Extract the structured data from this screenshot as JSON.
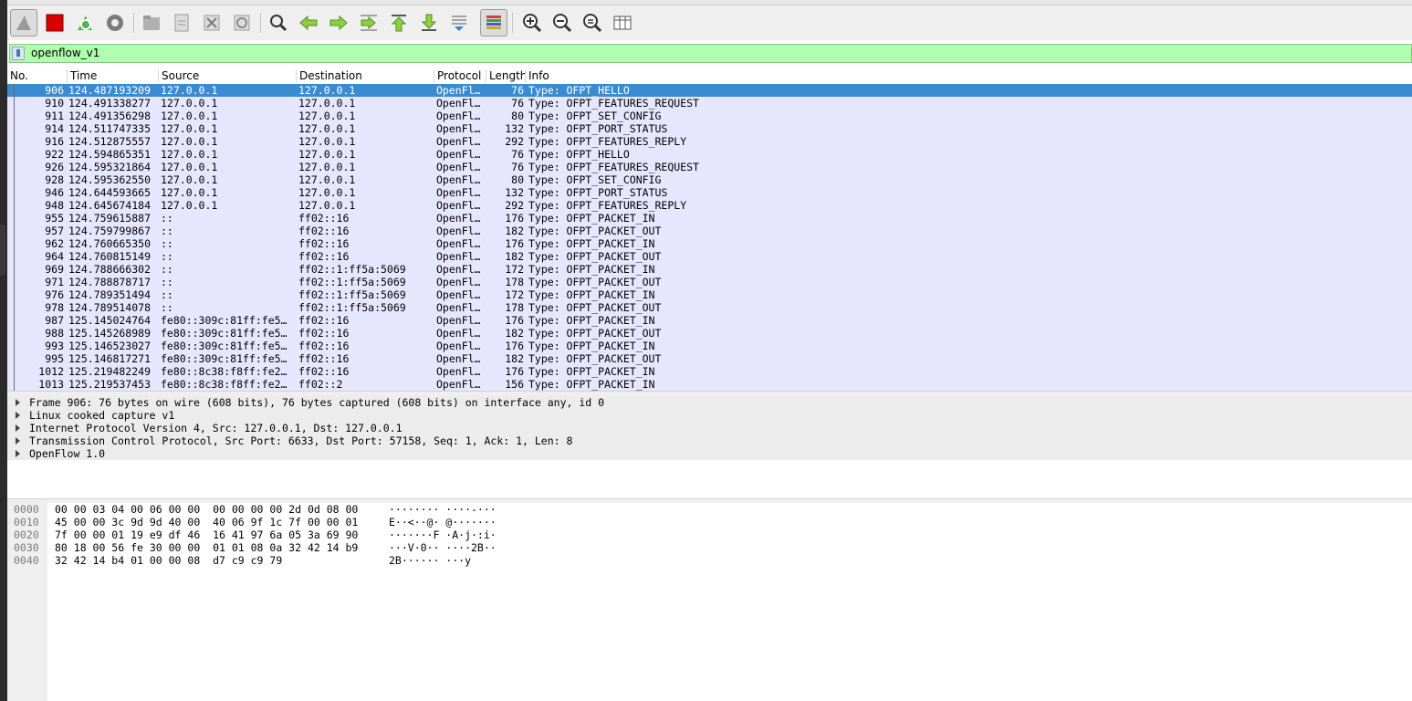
{
  "app": {
    "accent_selected_row": "#3b8bd0",
    "packet_bg": "#e7e6ff",
    "filter_bg": "#afffaf"
  },
  "toolbar": {
    "buttons": [
      {
        "icon": "shark-fin-icon"
      },
      {
        "icon": "stop-icon"
      },
      {
        "icon": "restart-icon"
      },
      {
        "icon": "capture-options-icon"
      },
      {
        "icon": "open-file-icon"
      },
      {
        "icon": "save-file-icon"
      },
      {
        "icon": "close-file-icon"
      },
      {
        "icon": "reload-file-icon"
      },
      {
        "icon": "find-packet-icon"
      },
      {
        "icon": "go-back-icon"
      },
      {
        "icon": "go-forward-icon"
      },
      {
        "icon": "go-to-packet-icon"
      },
      {
        "icon": "go-first-icon"
      },
      {
        "icon": "go-last-icon"
      },
      {
        "icon": "autoscroll-icon"
      },
      {
        "icon": "colorize-icon"
      },
      {
        "icon": "zoom-in-icon"
      },
      {
        "icon": "zoom-out-icon"
      },
      {
        "icon": "normal-size-icon"
      },
      {
        "icon": "resize-columns-icon"
      }
    ]
  },
  "filter": {
    "value": "openflow_v1"
  },
  "columns": {
    "no": "No.",
    "time": "Time",
    "source": "Source",
    "destination": "Destination",
    "protocol": "Protocol",
    "length": "Length",
    "info": "Info"
  },
  "packets": [
    {
      "no": "906",
      "time": "124.487193209",
      "source": "127.0.0.1",
      "destination": "127.0.0.1",
      "protocol": "OpenFl…",
      "length": "76",
      "info": "Type: OFPT_HELLO"
    },
    {
      "no": "910",
      "time": "124.491338277",
      "source": "127.0.0.1",
      "destination": "127.0.0.1",
      "protocol": "OpenFl…",
      "length": "76",
      "info": "Type: OFPT_FEATURES_REQUEST"
    },
    {
      "no": "911",
      "time": "124.491356298",
      "source": "127.0.0.1",
      "destination": "127.0.0.1",
      "protocol": "OpenFl…",
      "length": "80",
      "info": "Type: OFPT_SET_CONFIG"
    },
    {
      "no": "914",
      "time": "124.511747335",
      "source": "127.0.0.1",
      "destination": "127.0.0.1",
      "protocol": "OpenFl…",
      "length": "132",
      "info": "Type: OFPT_PORT_STATUS"
    },
    {
      "no": "916",
      "time": "124.512875557",
      "source": "127.0.0.1",
      "destination": "127.0.0.1",
      "protocol": "OpenFl…",
      "length": "292",
      "info": "Type: OFPT_FEATURES_REPLY"
    },
    {
      "no": "922",
      "time": "124.594865351",
      "source": "127.0.0.1",
      "destination": "127.0.0.1",
      "protocol": "OpenFl…",
      "length": "76",
      "info": "Type: OFPT_HELLO"
    },
    {
      "no": "926",
      "time": "124.595321864",
      "source": "127.0.0.1",
      "destination": "127.0.0.1",
      "protocol": "OpenFl…",
      "length": "76",
      "info": "Type: OFPT_FEATURES_REQUEST"
    },
    {
      "no": "928",
      "time": "124.595362550",
      "source": "127.0.0.1",
      "destination": "127.0.0.1",
      "protocol": "OpenFl…",
      "length": "80",
      "info": "Type: OFPT_SET_CONFIG"
    },
    {
      "no": "946",
      "time": "124.644593665",
      "source": "127.0.0.1",
      "destination": "127.0.0.1",
      "protocol": "OpenFl…",
      "length": "132",
      "info": "Type: OFPT_PORT_STATUS"
    },
    {
      "no": "948",
      "time": "124.645674184",
      "source": "127.0.0.1",
      "destination": "127.0.0.1",
      "protocol": "OpenFl…",
      "length": "292",
      "info": "Type: OFPT_FEATURES_REPLY"
    },
    {
      "no": "955",
      "time": "124.759615887",
      "source": "::",
      "destination": "ff02::16",
      "protocol": "OpenFl…",
      "length": "176",
      "info": "Type: OFPT_PACKET_IN"
    },
    {
      "no": "957",
      "time": "124.759799867",
      "source": "::",
      "destination": "ff02::16",
      "protocol": "OpenFl…",
      "length": "182",
      "info": "Type: OFPT_PACKET_OUT"
    },
    {
      "no": "962",
      "time": "124.760665350",
      "source": "::",
      "destination": "ff02::16",
      "protocol": "OpenFl…",
      "length": "176",
      "info": "Type: OFPT_PACKET_IN"
    },
    {
      "no": "964",
      "time": "124.760815149",
      "source": "::",
      "destination": "ff02::16",
      "protocol": "OpenFl…",
      "length": "182",
      "info": "Type: OFPT_PACKET_OUT"
    },
    {
      "no": "969",
      "time": "124.788666302",
      "source": "::",
      "destination": "ff02::1:ff5a:5069",
      "protocol": "OpenFl…",
      "length": "172",
      "info": "Type: OFPT_PACKET_IN"
    },
    {
      "no": "971",
      "time": "124.788878717",
      "source": "::",
      "destination": "ff02::1:ff5a:5069",
      "protocol": "OpenFl…",
      "length": "178",
      "info": "Type: OFPT_PACKET_OUT"
    },
    {
      "no": "976",
      "time": "124.789351494",
      "source": "::",
      "destination": "ff02::1:ff5a:5069",
      "protocol": "OpenFl…",
      "length": "172",
      "info": "Type: OFPT_PACKET_IN"
    },
    {
      "no": "978",
      "time": "124.789514078",
      "source": "::",
      "destination": "ff02::1:ff5a:5069",
      "protocol": "OpenFl…",
      "length": "178",
      "info": "Type: OFPT_PACKET_OUT"
    },
    {
      "no": "987",
      "time": "125.145024764",
      "source": "fe80::309c:81ff:fe5…",
      "destination": "ff02::16",
      "protocol": "OpenFl…",
      "length": "176",
      "info": "Type: OFPT_PACKET_IN"
    },
    {
      "no": "988",
      "time": "125.145268989",
      "source": "fe80::309c:81ff:fe5…",
      "destination": "ff02::16",
      "protocol": "OpenFl…",
      "length": "182",
      "info": "Type: OFPT_PACKET_OUT"
    },
    {
      "no": "993",
      "time": "125.146523027",
      "source": "fe80::309c:81ff:fe5…",
      "destination": "ff02::16",
      "protocol": "OpenFl…",
      "length": "176",
      "info": "Type: OFPT_PACKET_IN"
    },
    {
      "no": "995",
      "time": "125.146817271",
      "source": "fe80::309c:81ff:fe5…",
      "destination": "ff02::16",
      "protocol": "OpenFl…",
      "length": "182",
      "info": "Type: OFPT_PACKET_OUT"
    },
    {
      "no": "1012",
      "time": "125.219482249",
      "source": "fe80::8c38:f8ff:fe2…",
      "destination": "ff02::16",
      "protocol": "OpenFl…",
      "length": "176",
      "info": "Type: OFPT_PACKET_IN"
    },
    {
      "no": "1013",
      "time": "125.219537453",
      "source": "fe80::8c38:f8ff:fe2…",
      "destination": "ff02::2",
      "protocol": "OpenFl…",
      "length": "156",
      "info": "Type: OFPT_PACKET_IN"
    }
  ],
  "details": [
    "Frame 906: 76 bytes on wire (608 bits), 76 bytes captured (608 bits) on interface any, id 0",
    "Linux cooked capture v1",
    "Internet Protocol Version 4, Src: 127.0.0.1, Dst: 127.0.0.1",
    "Transmission Control Protocol, Src Port: 6633, Dst Port: 57158, Seq: 1, Ack: 1, Len: 8",
    "OpenFlow 1.0"
  ],
  "bytes": [
    {
      "offset": "0000",
      "hex": "00 00 03 04 00 06 00 00  00 00 00 00 2d 0d 08 00",
      "ascii": "········ ····-···"
    },
    {
      "offset": "0010",
      "hex": "45 00 00 3c 9d 9d 40 00  40 06 9f 1c 7f 00 00 01",
      "ascii": "E··<··@· @·······"
    },
    {
      "offset": "0020",
      "hex": "7f 00 00 01 19 e9 df 46  16 41 97 6a 05 3a 69 90",
      "ascii": "·······F ·A·j·:i·"
    },
    {
      "offset": "0030",
      "hex": "80 18 00 56 fe 30 00 00  01 01 08 0a 32 42 14 b9",
      "ascii": "···V·0·· ····2B··"
    },
    {
      "offset": "0040",
      "hex": "32 42 14 b4 01 00 00 08  d7 c9 c9 79",
      "ascii": "2B······ ···y"
    }
  ]
}
